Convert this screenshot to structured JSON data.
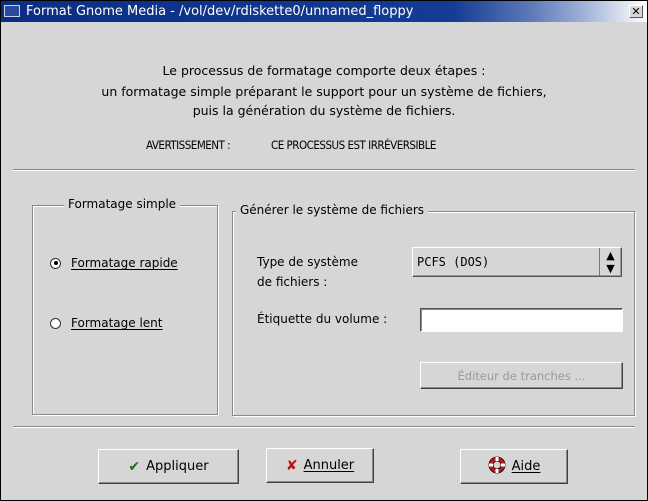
{
  "window": {
    "title": "Format Gnome Media - /vol/dev/rdiskette0/unnamed_floppy"
  },
  "intro": [
    "Le processus de formatage comporte deux étapes :",
    "un formatage simple préparant le support pour un système de fichiers,",
    "puis la génération du système de fichiers."
  ],
  "warning": {
    "label": "AVERTISSEMENT :",
    "text": "CE PROCESSUS EST IRRÉVERSIBLE"
  },
  "simple_format": {
    "title": "Formatage simple",
    "options": [
      {
        "label": "Formatage rapide",
        "mnemonic": "F",
        "selected": true
      },
      {
        "label": "Formatage lent",
        "mnemonic": "F",
        "selected": false
      }
    ]
  },
  "filesystem": {
    "title": "Générer le système de fichiers",
    "type_label_line1": "Type de système",
    "type_label_line2": "de fichiers :",
    "type_value": "PCFS (DOS)",
    "volume_label": "Étiquette du volume :",
    "volume_value": "",
    "slice_editor_label": "Éditeur de tranches ..."
  },
  "buttons": {
    "apply": "Appliquer",
    "cancel": "Annuler",
    "help": "Aide"
  },
  "icon_names": [
    "window-menu-icon",
    "close-icon",
    "radio-icon",
    "spin-arrows-icon",
    "checkmark-icon",
    "cancel-x-icon",
    "lifebuoy-help-icon"
  ]
}
